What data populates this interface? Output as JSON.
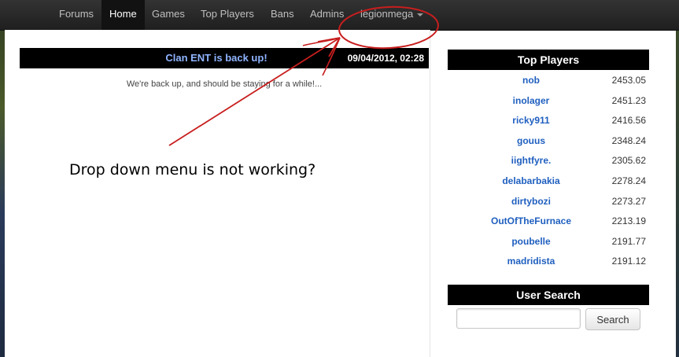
{
  "navbar": {
    "items": [
      {
        "label": "Forums"
      },
      {
        "label": "Home",
        "active": true
      },
      {
        "label": "Games"
      },
      {
        "label": "Top Players"
      },
      {
        "label": "Bans"
      },
      {
        "label": "Admins"
      }
    ],
    "user_menu": {
      "label": "legionmega",
      "icon": "caret-down-icon"
    }
  },
  "news": {
    "title": "Clan ENT is back up!",
    "date": "09/04/2012, 02:28",
    "body": "We're back up, and should be staying for a while!..."
  },
  "sidebar": {
    "top_players": {
      "title": "Top Players",
      "players": [
        {
          "name": "nob",
          "score": "2453.05"
        },
        {
          "name": "inolager",
          "score": "2451.23"
        },
        {
          "name": "ricky911",
          "score": "2416.56"
        },
        {
          "name": "gouus",
          "score": "2348.24"
        },
        {
          "name": "iightfyre.",
          "score": "2305.62"
        },
        {
          "name": "delabarbakia",
          "score": "2278.24"
        },
        {
          "name": "dirtybozi",
          "score": "2273.27"
        },
        {
          "name": "OutOfTheFurnace",
          "score": "2213.19"
        },
        {
          "name": "poubelle",
          "score": "2191.77"
        },
        {
          "name": "madridista",
          "score": "2191.12"
        }
      ]
    },
    "user_search": {
      "title": "User Search",
      "input_value": "",
      "button_label": "Search"
    }
  },
  "annotation": {
    "text": "Drop down menu is not working?",
    "color": "#c81e1e"
  }
}
